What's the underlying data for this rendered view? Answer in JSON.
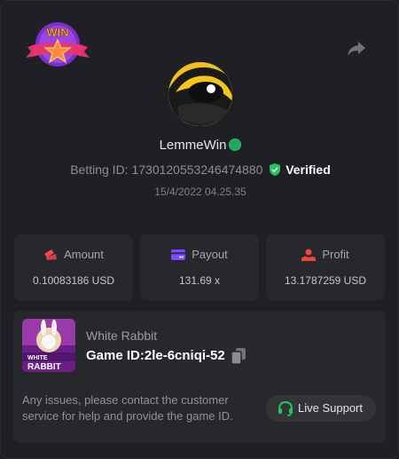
{
  "user": {
    "name": "LemmeWin",
    "betting_label": "Betting ID:",
    "betting_id": "1730120553246474880",
    "verified_label": "Verified",
    "timestamp": "15/4/2022 04.25.35"
  },
  "badge": {
    "text": "WIN"
  },
  "stats": {
    "amount": {
      "label": "Amount",
      "value": "0.10083186 USD"
    },
    "payout": {
      "label": "Payout",
      "value": "131.69 x"
    },
    "profit": {
      "label": "Profit",
      "value": "13.1787259 USD"
    }
  },
  "game": {
    "name": "White Rabbit",
    "id_label": "Game ID:",
    "id": "2le-6cniqi-52",
    "thumb_text_1": "WHITE",
    "thumb_text_2": "RABBIT"
  },
  "support": {
    "help_text": "Any issues, please contact the customer service for help and provide the game ID.",
    "button_label": "Live Support"
  },
  "colors": {
    "background": "#1f2023",
    "card": "#27282c",
    "online": "#23a55a",
    "verified_shield": "#22c55e",
    "amount_icon": "#f0475a",
    "payout_icon": "#7c4dff",
    "profit_icon": "#ef4444"
  }
}
